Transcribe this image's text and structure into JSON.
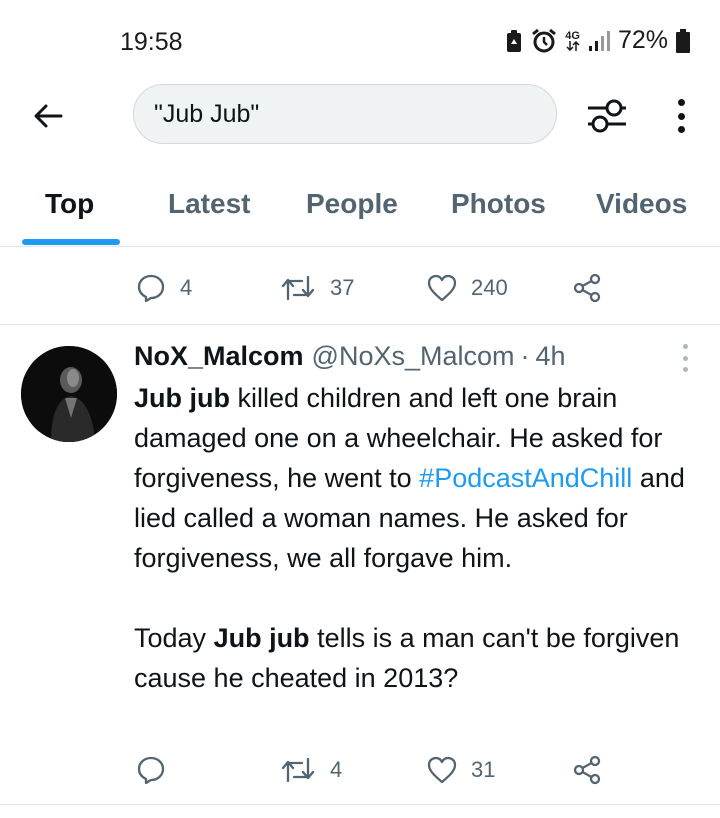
{
  "status_bar": {
    "time": "19:58",
    "network": "4G",
    "battery": "72%",
    "icons": [
      "battery-saver-icon",
      "alarm-icon",
      "network-4g-icon",
      "signal-icon",
      "battery-icon"
    ]
  },
  "search": {
    "query": "\"Jub Jub\"",
    "icons": [
      "back-arrow-icon",
      "filter-sliders-icon",
      "more-vertical-icon"
    ]
  },
  "tabs": [
    {
      "label": "Top",
      "active": true
    },
    {
      "label": "Latest",
      "active": false
    },
    {
      "label": "People",
      "active": false
    },
    {
      "label": "Photos",
      "active": false
    },
    {
      "label": "Videos",
      "active": false
    }
  ],
  "previous_tweet_actions": {
    "replies": "4",
    "retweets": "37",
    "likes": "240"
  },
  "tweet": {
    "display_name": "NoX_Malcom",
    "handle": "@NoXs_Malcom",
    "separator": "·",
    "time": "4h",
    "body": {
      "p1_bold1": "Jub jub",
      "p1_text1": " killed children and left one brain damaged one on a wheelchair. He asked for forgiveness,  he went to ",
      "hashtag": "#PodcastAndChill",
      "p1_text2": " and lied called a woman names. He asked for forgiveness, we all forgave him.",
      "p2_text1": "Today ",
      "p2_bold1": "Jub jub",
      "p2_text2": " tells is a man can't be forgiven cause he cheated in 2013?"
    },
    "actions": {
      "replies": "",
      "retweets": "4",
      "likes": "31"
    }
  },
  "colors": {
    "accent": "#1d9bf0",
    "text_primary": "#0f1419",
    "text_secondary": "#536471",
    "divider": "#e1e6ea",
    "search_bg": "#eff3f4"
  }
}
